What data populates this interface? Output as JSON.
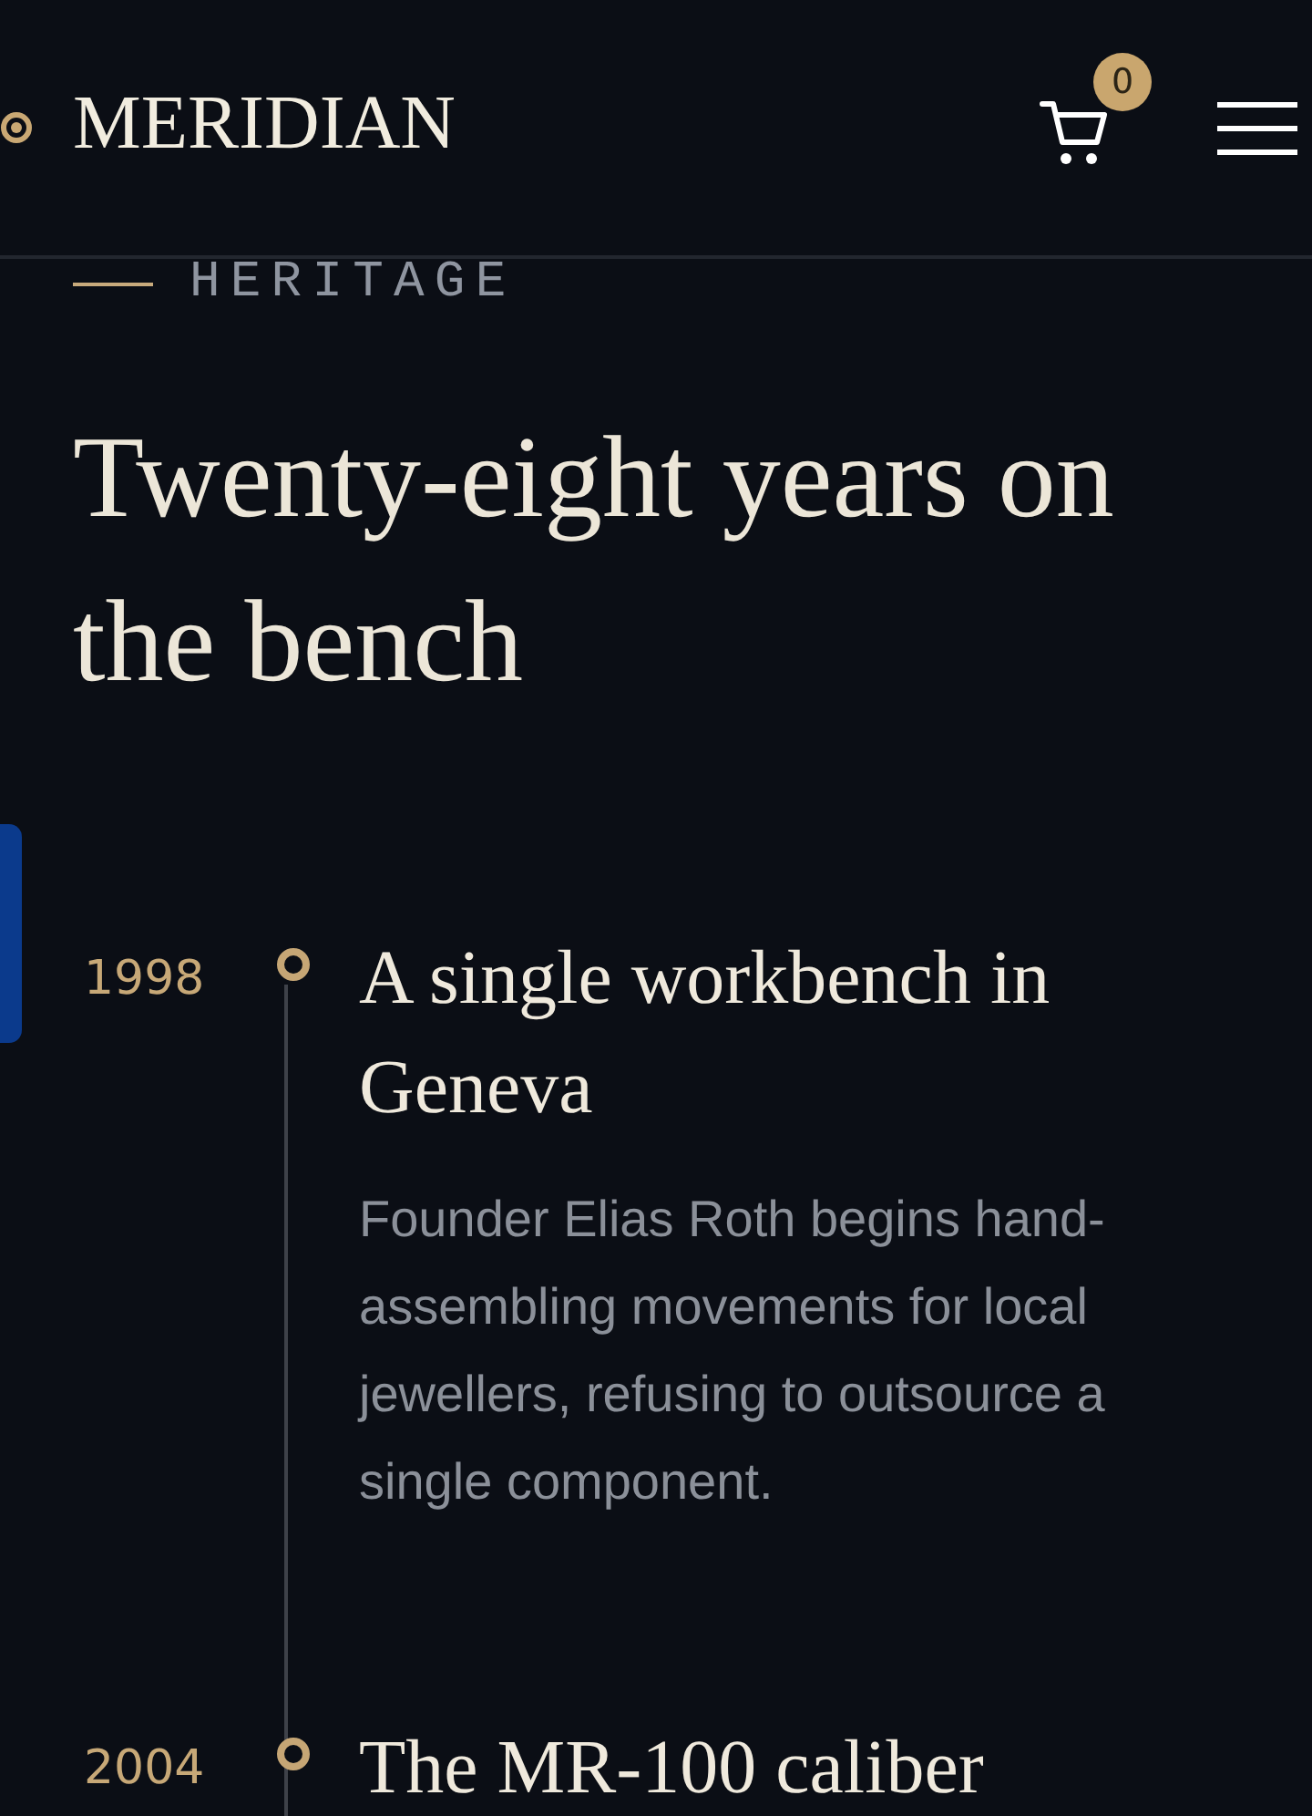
{
  "header": {
    "brand": "MERIDIAN",
    "cart_count": "0"
  },
  "section": {
    "eyebrow": "HERITAGE",
    "heading": "Twenty-eight years on the bench"
  },
  "timeline": [
    {
      "year": "1998",
      "title": "A single workbench in Geneva",
      "description": "Founder Elias Roth begins hand-assembling movements for local jewellers, refusing to outsource a single component."
    },
    {
      "year": "2004",
      "title": "The MR-100 caliber"
    }
  ]
}
